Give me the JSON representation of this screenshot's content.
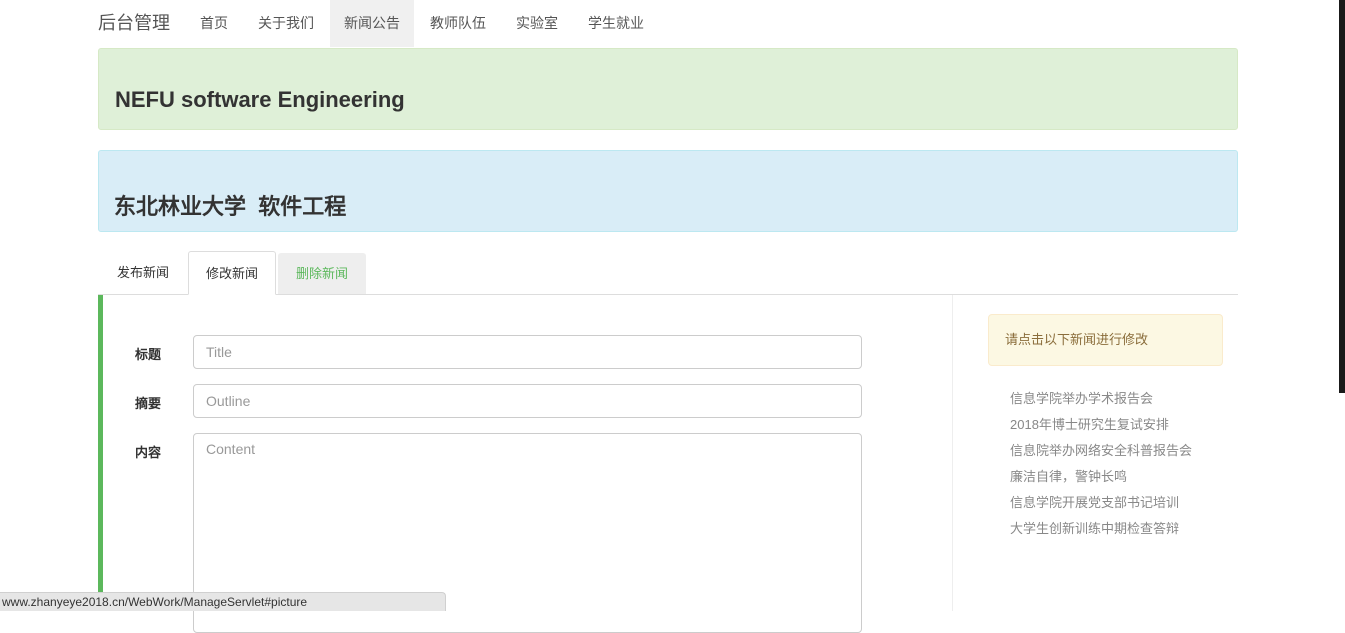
{
  "navbar": {
    "brand": "后台管理",
    "items": [
      {
        "label": "首页",
        "active": false
      },
      {
        "label": "关于我们",
        "active": false
      },
      {
        "label": "新闻公告",
        "active": true
      },
      {
        "label": "教师队伍",
        "active": false
      },
      {
        "label": "实验室",
        "active": false
      },
      {
        "label": "学生就业",
        "active": false
      }
    ]
  },
  "banner_green": {
    "title": "NEFU software Engineering"
  },
  "banner_blue": {
    "title": "东北林业大学  软件工程"
  },
  "tabs": [
    {
      "label": "发布新闻"
    },
    {
      "label": "修改新闻"
    },
    {
      "label": "删除新闻"
    }
  ],
  "form": {
    "title_label": "标题",
    "title_placeholder": "Title",
    "outline_label": "摘要",
    "outline_placeholder": "Outline",
    "content_label": "内容",
    "content_placeholder": "Content"
  },
  "sidebar": {
    "alert": "请点击以下新闻进行修改",
    "news": [
      "信息学院举办学术报告会",
      "2018年博士研究生复试安排",
      "信息院举办网络安全科普报告会",
      "廉洁自律，警钟长鸣",
      "信息学院开展党支部书记培训",
      "大学生创新训练中期检查答辩"
    ]
  },
  "status_bar": {
    "url": "www.zhanyeye2018.cn/WebWork/ManageServlet#picture"
  },
  "colors": {
    "accent_green": "#5cb85c",
    "banner_green_bg": "#dff0d8",
    "banner_blue_bg": "#d9edf7",
    "alert_bg": "#fcf8e3"
  }
}
